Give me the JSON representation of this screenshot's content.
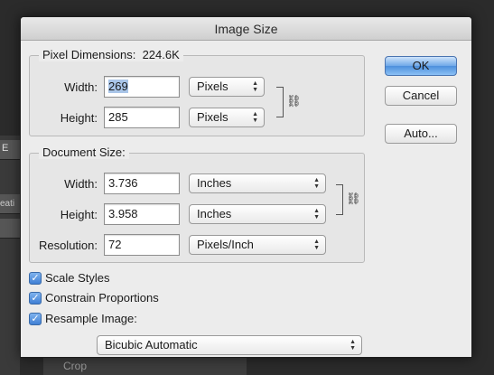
{
  "background": {
    "tab_text": "E",
    "side_text": "eati",
    "bottom_text": "Crop"
  },
  "dialog": {
    "title": "Image Size",
    "pixel_dimensions": {
      "title": "Pixel Dimensions:",
      "size": "224.6K",
      "width_label": "Width:",
      "width_value": "269",
      "width_unit": "Pixels",
      "height_label": "Height:",
      "height_value": "285",
      "height_unit": "Pixels"
    },
    "document_size": {
      "title": "Document Size:",
      "width_label": "Width:",
      "width_value": "3.736",
      "width_unit": "Inches",
      "height_label": "Height:",
      "height_value": "3.958",
      "height_unit": "Inches",
      "resolution_label": "Resolution:",
      "resolution_value": "72",
      "resolution_unit": "Pixels/Inch"
    },
    "options": {
      "scale_styles": "Scale Styles",
      "constrain_proportions": "Constrain Proportions",
      "resample_image": "Resample Image:",
      "resample_method": "Bicubic Automatic"
    },
    "buttons": {
      "ok": "OK",
      "cancel": "Cancel",
      "auto": "Auto..."
    }
  }
}
